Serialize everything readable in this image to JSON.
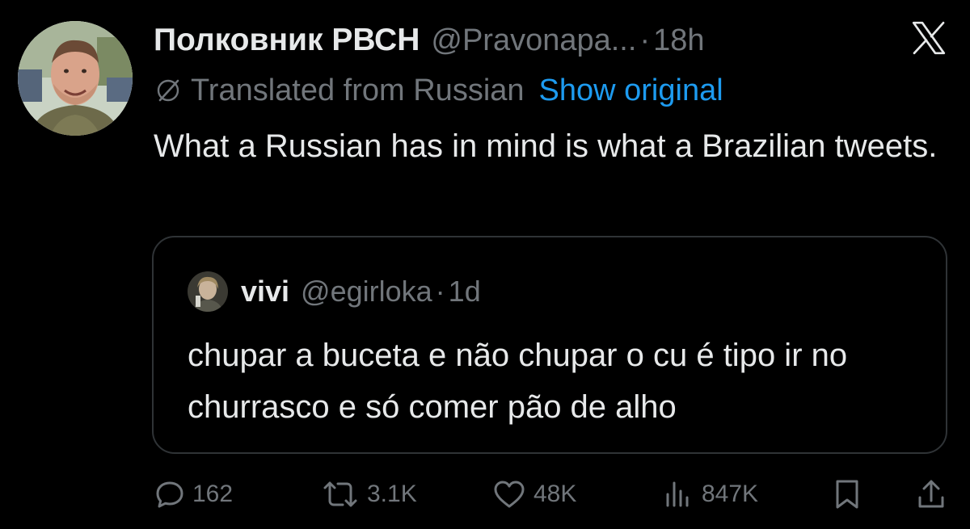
{
  "tweet": {
    "display_name": "Полковник РВСН",
    "handle": "@Pravonapa...",
    "separator": "·",
    "time": "18h",
    "translated_label": "Translated from Russian",
    "show_original_label": "Show original",
    "text": "What a Russian has in mind is what a Brazilian tweets."
  },
  "quote": {
    "display_name": "vivi",
    "handle": "@egirloka",
    "separator": "·",
    "time": "1d",
    "text": "chupar a buceta e não chupar o cu é tipo ir no churrasco e só comer pão de alho"
  },
  "actions": {
    "replies": "162",
    "reposts": "3.1K",
    "likes": "48K",
    "views": "847K"
  },
  "icons": {
    "reply": "reply-icon",
    "repost": "repost-icon",
    "like": "heart-icon",
    "views": "views-icon",
    "bookmark": "bookmark-icon",
    "share": "share-icon",
    "logo": "x-logo-icon",
    "translate": "globe-slash-icon"
  },
  "colors": {
    "background": "#000000",
    "text_primary": "#e7e9ea",
    "text_secondary": "#71767b",
    "link": "#1d9bf0",
    "border": "#2f3336"
  }
}
